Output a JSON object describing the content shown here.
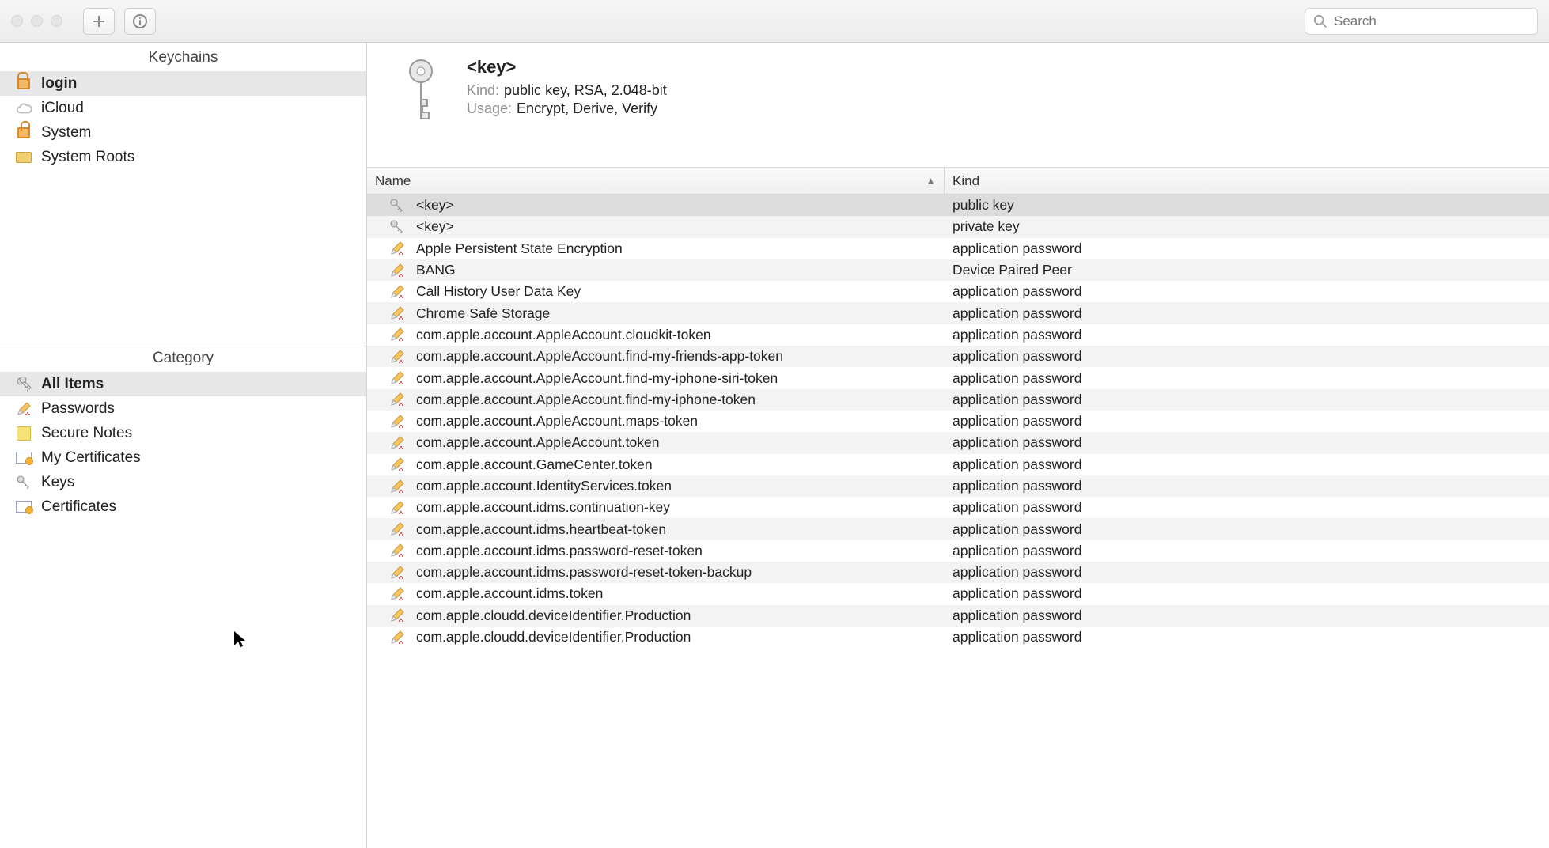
{
  "toolbar": {
    "search_placeholder": "Search"
  },
  "sidebar": {
    "keychains_title": "Keychains",
    "category_title": "Category",
    "keychains": [
      {
        "label": "login",
        "icon": "lock-open-icon",
        "selected": true
      },
      {
        "label": "iCloud",
        "icon": "cloud-icon",
        "selected": false
      },
      {
        "label": "System",
        "icon": "lock-closed-icon",
        "selected": false
      },
      {
        "label": "System Roots",
        "icon": "folder-icon",
        "selected": false
      }
    ],
    "categories": [
      {
        "label": "All Items",
        "icon": "keys-icon",
        "selected": true
      },
      {
        "label": "Passwords",
        "icon": "pencil-icon",
        "selected": false
      },
      {
        "label": "Secure Notes",
        "icon": "note-icon",
        "selected": false
      },
      {
        "label": "My Certificates",
        "icon": "certificate-icon",
        "selected": false
      },
      {
        "label": "Keys",
        "icon": "key-icon",
        "selected": false
      },
      {
        "label": "Certificates",
        "icon": "certificate-icon",
        "selected": false
      }
    ]
  },
  "detail": {
    "title": "<key>",
    "kind_label": "Kind:",
    "kind_value": "public key, RSA, 2.048-bit",
    "usage_label": "Usage:",
    "usage_value": "Encrypt, Derive, Verify"
  },
  "table": {
    "columns": {
      "name": "Name",
      "kind": "Kind"
    },
    "sort_indicator": "▲",
    "rows": [
      {
        "name": "<key>",
        "kind": "public key",
        "icon": "key-icon",
        "selected": true
      },
      {
        "name": "<key>",
        "kind": "private key",
        "icon": "key-icon",
        "selected": false
      },
      {
        "name": "Apple Persistent State Encryption",
        "kind": "application password",
        "icon": "pencil-icon",
        "selected": false
      },
      {
        "name": "BANG",
        "kind": "Device Paired Peer",
        "icon": "pencil-icon",
        "selected": false
      },
      {
        "name": "Call History User Data Key",
        "kind": "application password",
        "icon": "pencil-icon",
        "selected": false
      },
      {
        "name": "Chrome Safe Storage",
        "kind": "application password",
        "icon": "pencil-icon",
        "selected": false
      },
      {
        "name": "com.apple.account.AppleAccount.cloudkit-token",
        "kind": "application password",
        "icon": "pencil-icon",
        "selected": false
      },
      {
        "name": "com.apple.account.AppleAccount.find-my-friends-app-token",
        "kind": "application password",
        "icon": "pencil-icon",
        "selected": false
      },
      {
        "name": "com.apple.account.AppleAccount.find-my-iphone-siri-token",
        "kind": "application password",
        "icon": "pencil-icon",
        "selected": false
      },
      {
        "name": "com.apple.account.AppleAccount.find-my-iphone-token",
        "kind": "application password",
        "icon": "pencil-icon",
        "selected": false
      },
      {
        "name": "com.apple.account.AppleAccount.maps-token",
        "kind": "application password",
        "icon": "pencil-icon",
        "selected": false
      },
      {
        "name": "com.apple.account.AppleAccount.token",
        "kind": "application password",
        "icon": "pencil-icon",
        "selected": false
      },
      {
        "name": "com.apple.account.GameCenter.token",
        "kind": "application password",
        "icon": "pencil-icon",
        "selected": false
      },
      {
        "name": "com.apple.account.IdentityServices.token",
        "kind": "application password",
        "icon": "pencil-icon",
        "selected": false
      },
      {
        "name": "com.apple.account.idms.continuation-key",
        "kind": "application password",
        "icon": "pencil-icon",
        "selected": false
      },
      {
        "name": "com.apple.account.idms.heartbeat-token",
        "kind": "application password",
        "icon": "pencil-icon",
        "selected": false
      },
      {
        "name": "com.apple.account.idms.password-reset-token",
        "kind": "application password",
        "icon": "pencil-icon",
        "selected": false
      },
      {
        "name": "com.apple.account.idms.password-reset-token-backup",
        "kind": "application password",
        "icon": "pencil-icon",
        "selected": false
      },
      {
        "name": "com.apple.account.idms.token",
        "kind": "application password",
        "icon": "pencil-icon",
        "selected": false
      },
      {
        "name": "com.apple.cloudd.deviceIdentifier.Production",
        "kind": "application password",
        "icon": "pencil-icon",
        "selected": false
      },
      {
        "name": "com.apple.cloudd.deviceIdentifier.Production",
        "kind": "application password",
        "icon": "pencil-icon",
        "selected": false
      }
    ]
  }
}
